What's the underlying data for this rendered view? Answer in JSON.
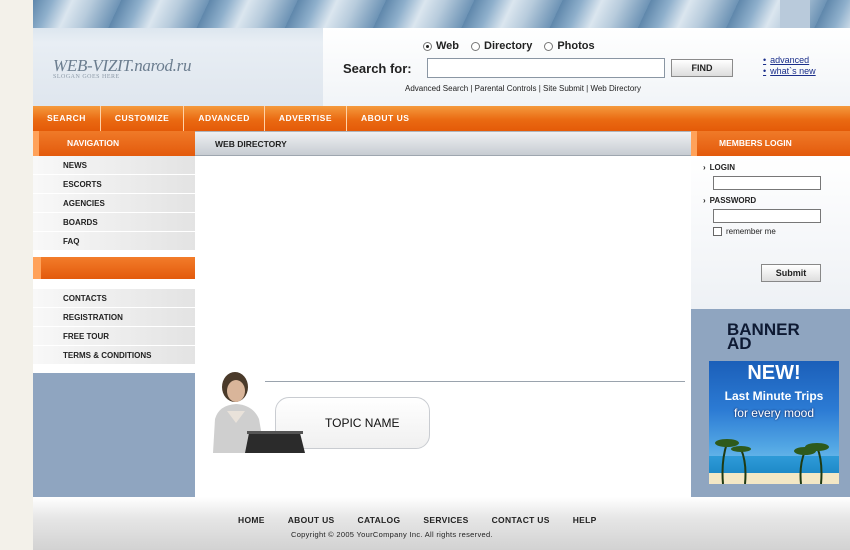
{
  "header": {
    "logo": "WEB-VIZIT.narod.ru",
    "slogan": "SLOGAN GOES HERE",
    "search_label": "Search for:",
    "find_button": "FIND",
    "radio_options": [
      "Web",
      "Directory",
      "Photos"
    ],
    "selected_radio": "Web",
    "advanced_link": "advanced",
    "whats_new_link": "what`s new",
    "sub_links": "Advanced Search  |  Parental Controls  |  Site Submit  |  Web Directory"
  },
  "topnav": [
    "SEARCH",
    "CUSTOMIZE",
    "ADVANCED",
    "ADVERTISE",
    "ABOUT US"
  ],
  "left_nav": {
    "title": "NAVIGATION",
    "items_top": [
      "NEWS",
      "ESCORTS",
      "AGENCIES",
      "BOARDS",
      "FAQ"
    ],
    "items_bottom": [
      "CONTACTS",
      "REGISTRATION",
      "FREE TOUR",
      "TERMS & CONDITIONS"
    ]
  },
  "center": {
    "title": "WEB DIRECTORY",
    "topic_name": "TOPIC NAME"
  },
  "members": {
    "title": "MEMBERS LOGIN",
    "login_label": "LOGIN",
    "password_label": "PASSWORD",
    "remember_label": "remember me",
    "submit_label": "Submit"
  },
  "banner": {
    "label_line1": "BANNER",
    "label_line2": "AD",
    "ad_new": "NEW!",
    "ad_line": "Last Minute Trips",
    "ad_mood": "for every mood"
  },
  "footer": {
    "links": [
      "HOME",
      "ABOUT US",
      "CATALOG",
      "SERVICES",
      "CONTACT US",
      "HELP"
    ],
    "copyright": "Copyright © 2005 YourCompany Inc. All rights reserved."
  },
  "colors": {
    "accent_orange": "#e8640e",
    "sidebar_blue": "#8fa5c0",
    "link_blue": "#1a2e8a"
  }
}
